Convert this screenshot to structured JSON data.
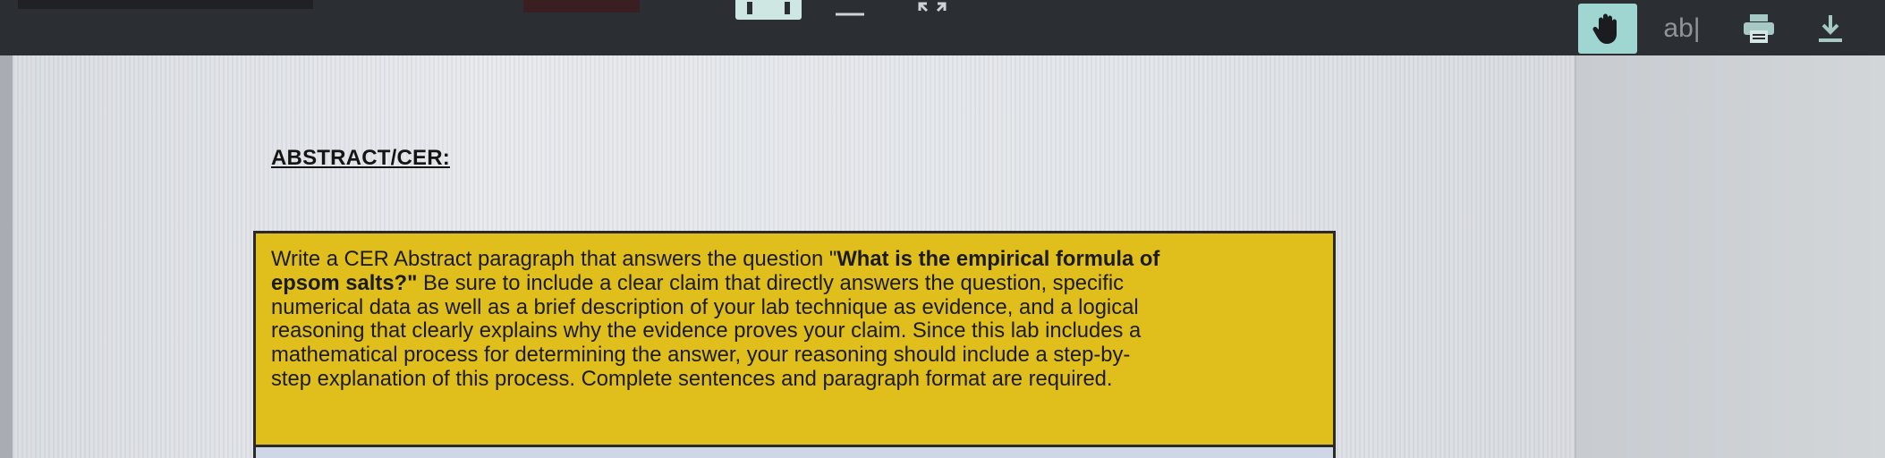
{
  "toolbar": {
    "text_tool_label": "ab|",
    "icons": [
      "view-mode-icon",
      "zoom-icon",
      "expand-icon",
      "hand-icon",
      "text-select-icon",
      "print-icon",
      "download-icon"
    ],
    "accent_color": "#9fd6d1"
  },
  "document": {
    "heading": "ABSTRACT/CER:",
    "instruction": {
      "box_color": "#e0be1c",
      "lines": [
        [
          "Write a CER Abstract paragraph that answers the question \"",
          "What is the empirical formula of"
        ],
        [
          "epsom salts?\"",
          " Be sure to include a clear claim that directly answers the question, specific"
        ],
        [
          "numerical data as well as a brief description of your lab technique as evidence, and a logical"
        ],
        [
          "reasoning that clearly explains why the evidence proves your claim.  Since this lab includes a"
        ],
        [
          "mathematical process for determining the answer, your reasoning should include a step-by-"
        ],
        [
          "step explanation of this process.  Complete sentences and paragraph format are required."
        ]
      ]
    }
  }
}
